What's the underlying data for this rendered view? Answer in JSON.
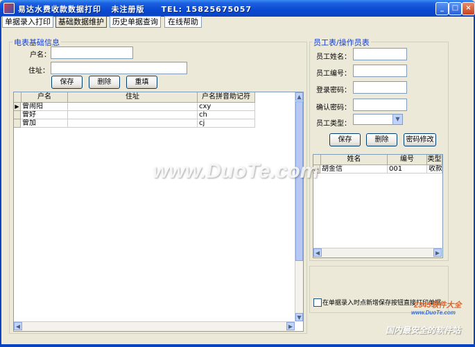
{
  "window": {
    "title": "易达水费收款数据打印   未注册版     TEL: 15825675057",
    "minimize": "_",
    "maximize": "□",
    "close": "×"
  },
  "tabs": [
    "单据录入打印",
    "基础数据维护",
    "历史单据查询",
    "在线帮助"
  ],
  "customer_section": {
    "title": "电表基础信息",
    "name_label": "户名：",
    "address_label": "住址：",
    "name_value": "",
    "address_value": "",
    "save": "保存",
    "delete": "删除",
    "refill": "重填",
    "columns": [
      "户名",
      "住址",
      "户名拼音助记符"
    ],
    "rows": [
      {
        "name": "曾闹阳",
        "address": "",
        "pinyin": "cxy"
      },
      {
        "name": "曾好",
        "address": "",
        "pinyin": "ch"
      },
      {
        "name": "曾加",
        "address": "",
        "pinyin": "cj"
      }
    ]
  },
  "staff_section": {
    "title": "员工表/操作员表",
    "name_label": "员工姓名：",
    "id_label": "员工编号：",
    "password_label": "登录密码：",
    "confirm_label": "确认密码：",
    "type_label": "员工类型：",
    "save": "保存",
    "delete": "删除",
    "change_password": "密码修改",
    "columns": [
      "姓名",
      "编号",
      "类型"
    ],
    "rows": [
      {
        "name": "胡金信",
        "id": "001",
        "type": "收款"
      }
    ]
  },
  "option": {
    "label": "在单据录入时点新增保存按钮直接打印单据",
    "checked": false
  },
  "watermark": {
    "main": "www.DuoTe.com",
    "corner_brand": "2345软件大全",
    "corner_url": "www.DuoTe.com",
    "corner_slogan": "国内最安全的软件站"
  }
}
